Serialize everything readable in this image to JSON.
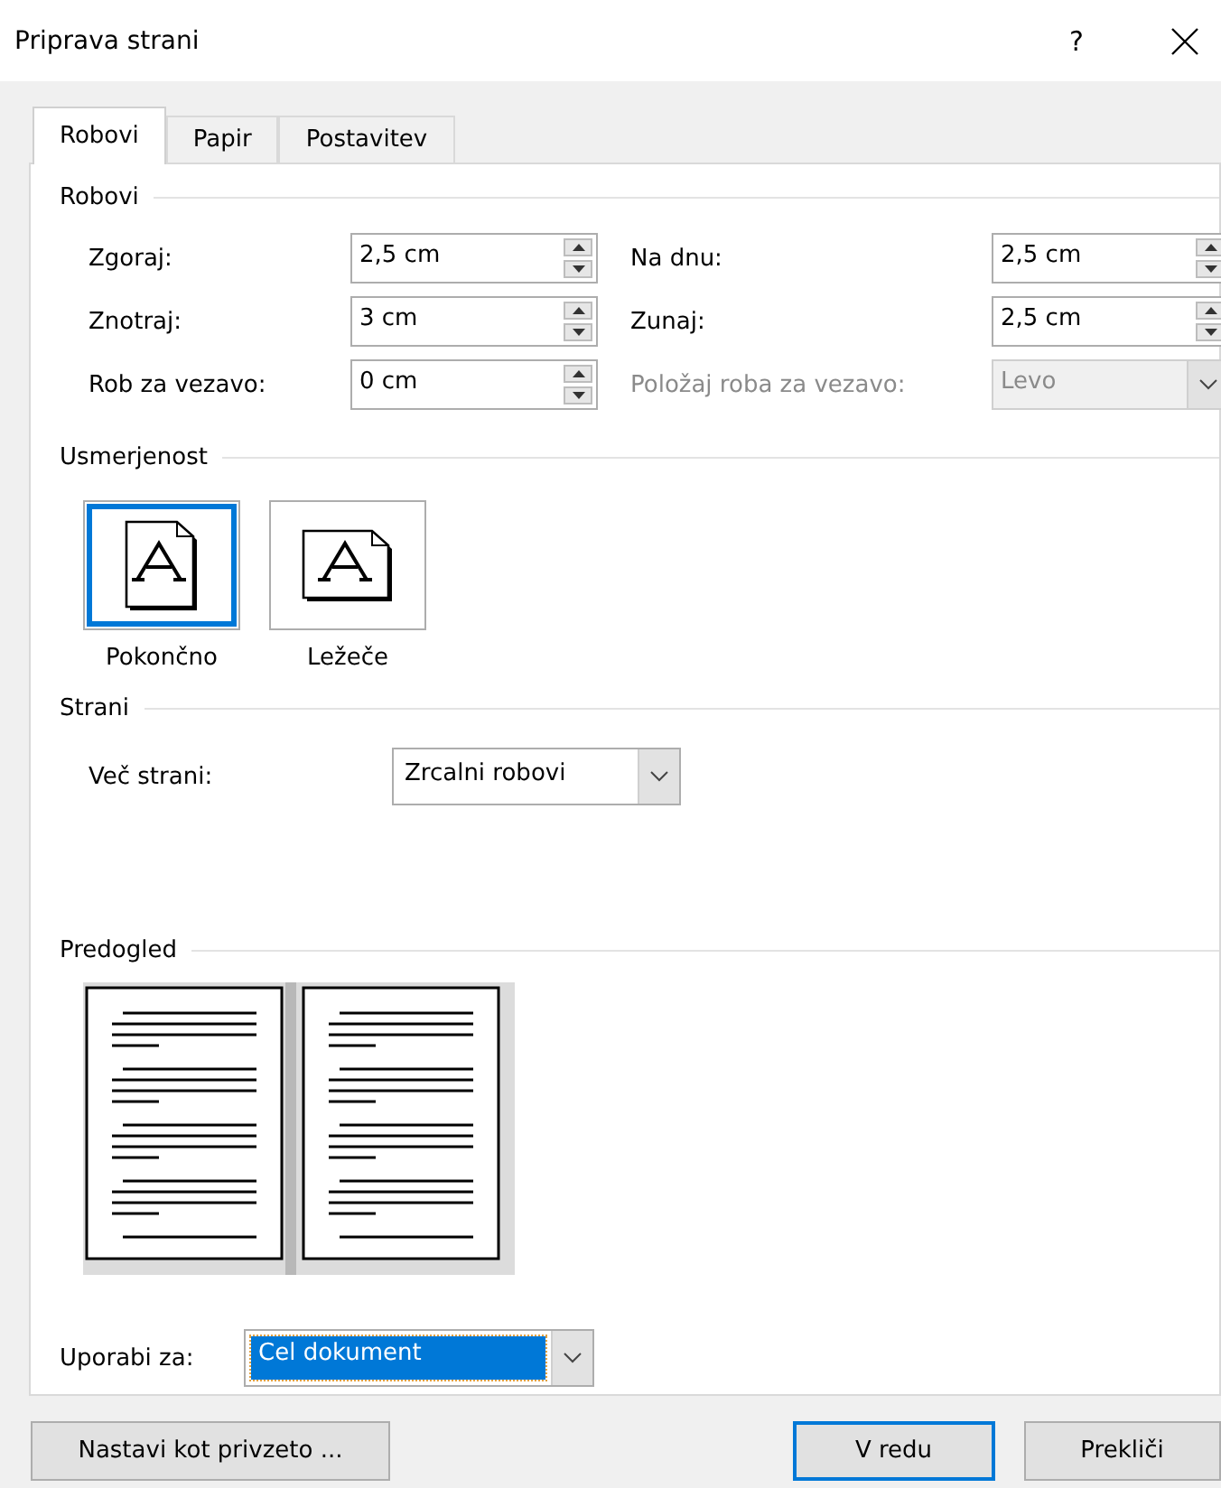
{
  "window": {
    "title": "Priprava strani",
    "help": "?"
  },
  "tabs": [
    {
      "label": "Robovi",
      "selected": true
    },
    {
      "label": "Papir",
      "selected": false
    },
    {
      "label": "Postavitev",
      "selected": false
    }
  ],
  "margins": {
    "heading": "Robovi",
    "fields": [
      {
        "kind": "spin",
        "label": "Zgoraj:",
        "value": "2,5 cm",
        "disabled": false
      },
      {
        "kind": "spin",
        "label": "Na dnu:",
        "value": "2,5 cm",
        "disabled": false
      },
      {
        "kind": "spin",
        "label": "Znotraj:",
        "value": "3 cm",
        "disabled": false
      },
      {
        "kind": "spin",
        "label": "Zunaj:",
        "value": "2,5 cm",
        "disabled": false
      },
      {
        "kind": "spin",
        "label": "Rob za vezavo:",
        "value": "0 cm",
        "disabled": false
      },
      {
        "kind": "dropdown",
        "label": "Položaj roba za vezavo:",
        "value": "Levo",
        "disabled": true
      }
    ]
  },
  "orientation": {
    "heading": "Usmerjenost",
    "options": [
      {
        "kind": "portrait",
        "label": "Pokončno",
        "selected": true
      },
      {
        "kind": "landscape",
        "label": "Ležeče",
        "selected": false
      }
    ]
  },
  "pages": {
    "heading": "Strani",
    "label": "Več strani:",
    "value": "Zrcalni robovi"
  },
  "preview": {
    "heading": "Predogled"
  },
  "apply_to": {
    "label": "Uporabi za:",
    "value": "Cel dokument",
    "selected": true
  },
  "buttons": [
    {
      "label": "Nastavi kot privzeto ...",
      "default": false
    },
    {
      "label": "V redu",
      "default": true
    },
    {
      "label": "Prekliči",
      "default": false
    }
  ]
}
